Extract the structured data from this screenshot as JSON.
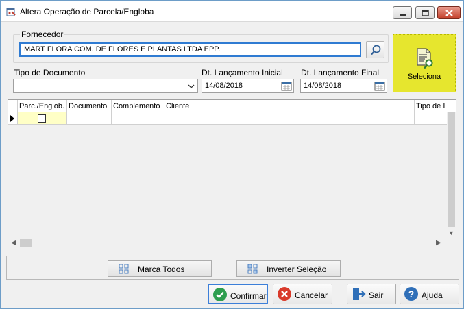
{
  "window": {
    "title": "Altera Operação de Parcela/Engloba"
  },
  "fornecedor": {
    "label": "Fornecedor",
    "value": "MART FLORA COM. DE FLORES E PLANTAS LTDA EPP."
  },
  "filters": {
    "tipo_documento": {
      "label": "Tipo de Documento",
      "value": ""
    },
    "dt_lancamento_inicial": {
      "label": "Dt. Lançamento Inicial",
      "value": "14/08/2018"
    },
    "dt_lancamento_final": {
      "label": "Dt. Lançamento Final",
      "value": "14/08/2018"
    }
  },
  "seleciona_button": {
    "label": "Seleciona",
    "color": "#e6e62e"
  },
  "grid": {
    "columns": [
      "Parc./Englob.",
      "Documento",
      "Complemento",
      "Cliente",
      "Tipo de I"
    ],
    "rows": [
      {
        "parc_englob_checked": false
      }
    ]
  },
  "toolbar": {
    "marca_todos": "Marca Todos",
    "inverter_selecao": "Inverter Seleção"
  },
  "actions": {
    "confirmar": "Confirmar",
    "cancelar": "Cancelar",
    "sair": "Sair",
    "ajuda": "Ajuda"
  },
  "icons": {
    "window": "app-window-icon",
    "search": "search-icon",
    "calendar": "calendar-icon",
    "seleciona": "document-search-icon",
    "confirmar": "check-icon",
    "cancelar": "cancel-icon",
    "sair": "exit-icon",
    "ajuda": "help-icon"
  }
}
